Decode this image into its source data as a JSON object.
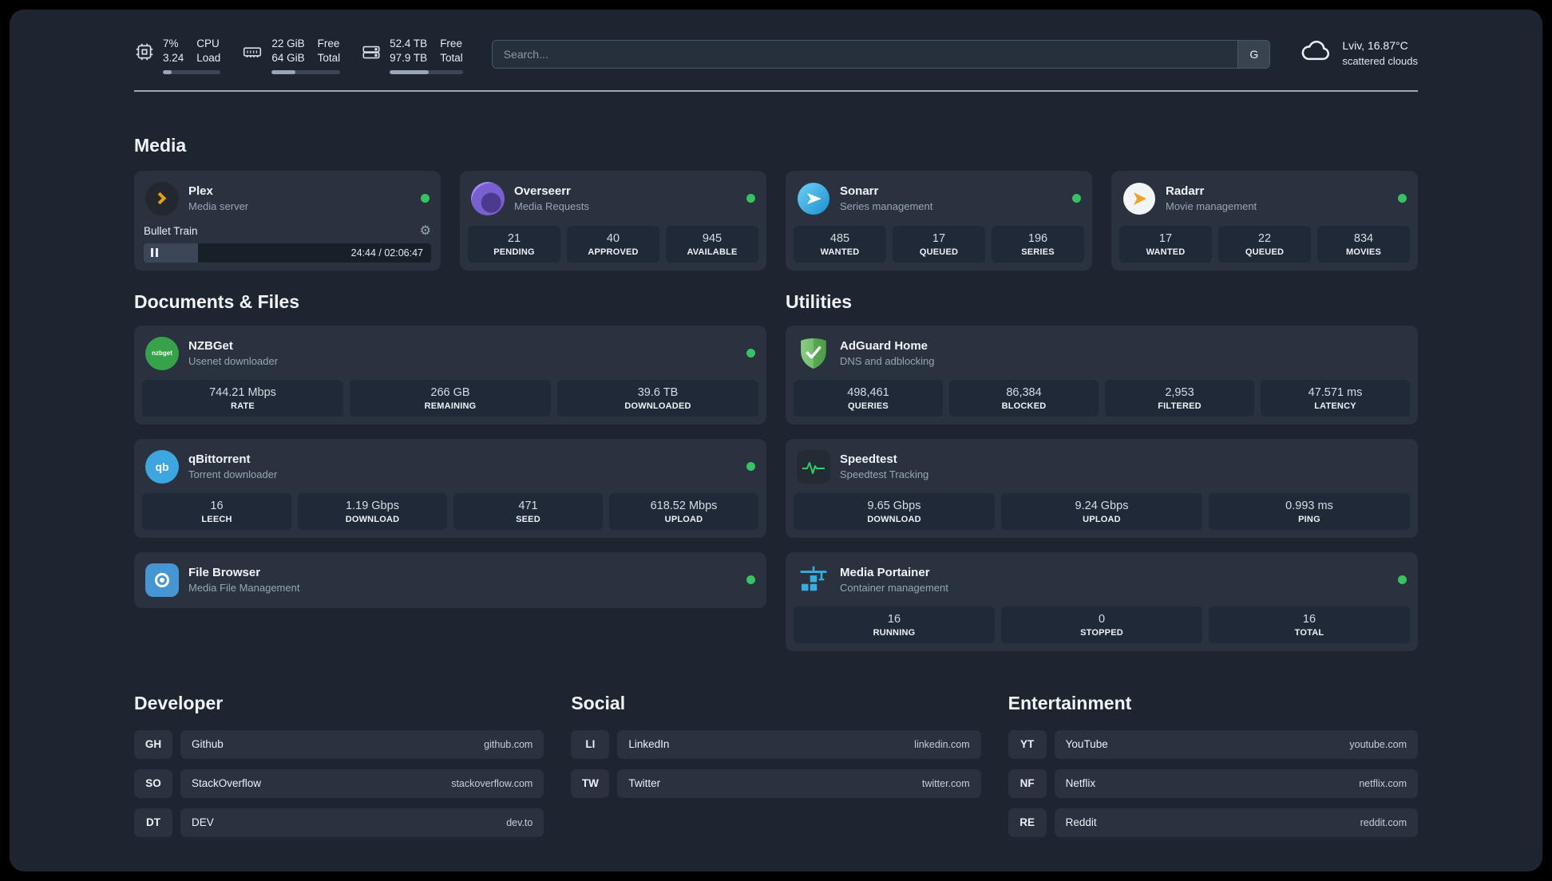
{
  "topbar": {
    "cpu": {
      "values": [
        "7%",
        "3.24"
      ],
      "labels": [
        "CPU",
        "Load"
      ],
      "progress": 15
    },
    "ram": {
      "values": [
        "22 GiB",
        "64 GiB"
      ],
      "labels": [
        "Free",
        "Total"
      ],
      "progress": 34
    },
    "disk": {
      "values": [
        "52.4 TB",
        "97.9 TB"
      ],
      "labels": [
        "Free",
        "Total"
      ],
      "progress": 53
    },
    "search": {
      "placeholder": "Search...",
      "engine": "G"
    },
    "weather": {
      "location": "Lviv, 16.87°C",
      "condition": "scattered clouds"
    }
  },
  "glyphs": {
    "gear": "⚙",
    "nzbget": "nzbget",
    "qbittorrent": "qb"
  },
  "colors": {
    "status_online": "#3ac162",
    "plex_accent": "#e5a00d"
  },
  "sections": {
    "media": {
      "title": "Media",
      "plex": {
        "name": "Plex",
        "subtitle": "Media server",
        "now_playing": {
          "title": "Bullet Train",
          "time": "24:44 / 02:06:47",
          "progress": 19
        }
      },
      "overseerr": {
        "name": "Overseerr",
        "subtitle": "Media Requests",
        "stats": [
          {
            "value": "21",
            "label": "PENDING"
          },
          {
            "value": "40",
            "label": "APPROVED"
          },
          {
            "value": "945",
            "label": "AVAILABLE"
          }
        ]
      },
      "sonarr": {
        "name": "Sonarr",
        "subtitle": "Series management",
        "stats": [
          {
            "value": "485",
            "label": "WANTED"
          },
          {
            "value": "17",
            "label": "QUEUED"
          },
          {
            "value": "196",
            "label": "SERIES"
          }
        ]
      },
      "radarr": {
        "name": "Radarr",
        "subtitle": "Movie management",
        "stats": [
          {
            "value": "17",
            "label": "WANTED"
          },
          {
            "value": "22",
            "label": "QUEUED"
          },
          {
            "value": "834",
            "label": "MOVIES"
          }
        ]
      }
    },
    "documents": {
      "title": "Documents & Files",
      "nzbget": {
        "name": "NZBGet",
        "subtitle": "Usenet downloader",
        "stats": [
          {
            "value": "744.21 Mbps",
            "label": "RATE"
          },
          {
            "value": "266 GB",
            "label": "REMAINING"
          },
          {
            "value": "39.6 TB",
            "label": "DOWNLOADED"
          }
        ]
      },
      "qbittorrent": {
        "name": "qBittorrent",
        "subtitle": "Torrent downloader",
        "stats": [
          {
            "value": "16",
            "label": "LEECH"
          },
          {
            "value": "1.19 Gbps",
            "label": "DOWNLOAD"
          },
          {
            "value": "471",
            "label": "SEED"
          },
          {
            "value": "618.52 Mbps",
            "label": "UPLOAD"
          }
        ]
      },
      "filebrowser": {
        "name": "File Browser",
        "subtitle": "Media File Management"
      }
    },
    "utilities": {
      "title": "Utilities",
      "adguard": {
        "name": "AdGuard Home",
        "subtitle": "DNS and adblocking",
        "stats": [
          {
            "value": "498,461",
            "label": "QUERIES"
          },
          {
            "value": "86,384",
            "label": "BLOCKED"
          },
          {
            "value": "2,953",
            "label": "FILTERED"
          },
          {
            "value": "47.571 ms",
            "label": "LATENCY"
          }
        ]
      },
      "speedtest": {
        "name": "Speedtest",
        "subtitle": "Speedtest Tracking",
        "stats": [
          {
            "value": "9.65 Gbps",
            "label": "DOWNLOAD"
          },
          {
            "value": "9.24 Gbps",
            "label": "UPLOAD"
          },
          {
            "value": "0.993 ms",
            "label": "PING"
          }
        ]
      },
      "portainer": {
        "name": "Media Portainer",
        "subtitle": "Container management",
        "stats": [
          {
            "value": "16",
            "label": "RUNNING"
          },
          {
            "value": "0",
            "label": "STOPPED"
          },
          {
            "value": "16",
            "label": "TOTAL"
          }
        ]
      }
    },
    "developer": {
      "title": "Developer",
      "links": [
        {
          "abbr": "GH",
          "name": "Github",
          "url": "github.com"
        },
        {
          "abbr": "SO",
          "name": "StackOverflow",
          "url": "stackoverflow.com"
        },
        {
          "abbr": "DT",
          "name": "DEV",
          "url": "dev.to"
        }
      ]
    },
    "social": {
      "title": "Social",
      "links": [
        {
          "abbr": "LI",
          "name": "LinkedIn",
          "url": "linkedin.com"
        },
        {
          "abbr": "TW",
          "name": "Twitter",
          "url": "twitter.com"
        }
      ]
    },
    "entertainment": {
      "title": "Entertainment",
      "links": [
        {
          "abbr": "YT",
          "name": "YouTube",
          "url": "youtube.com"
        },
        {
          "abbr": "NF",
          "name": "Netflix",
          "url": "netflix.com"
        },
        {
          "abbr": "RE",
          "name": "Reddit",
          "url": "reddit.com"
        }
      ]
    }
  }
}
